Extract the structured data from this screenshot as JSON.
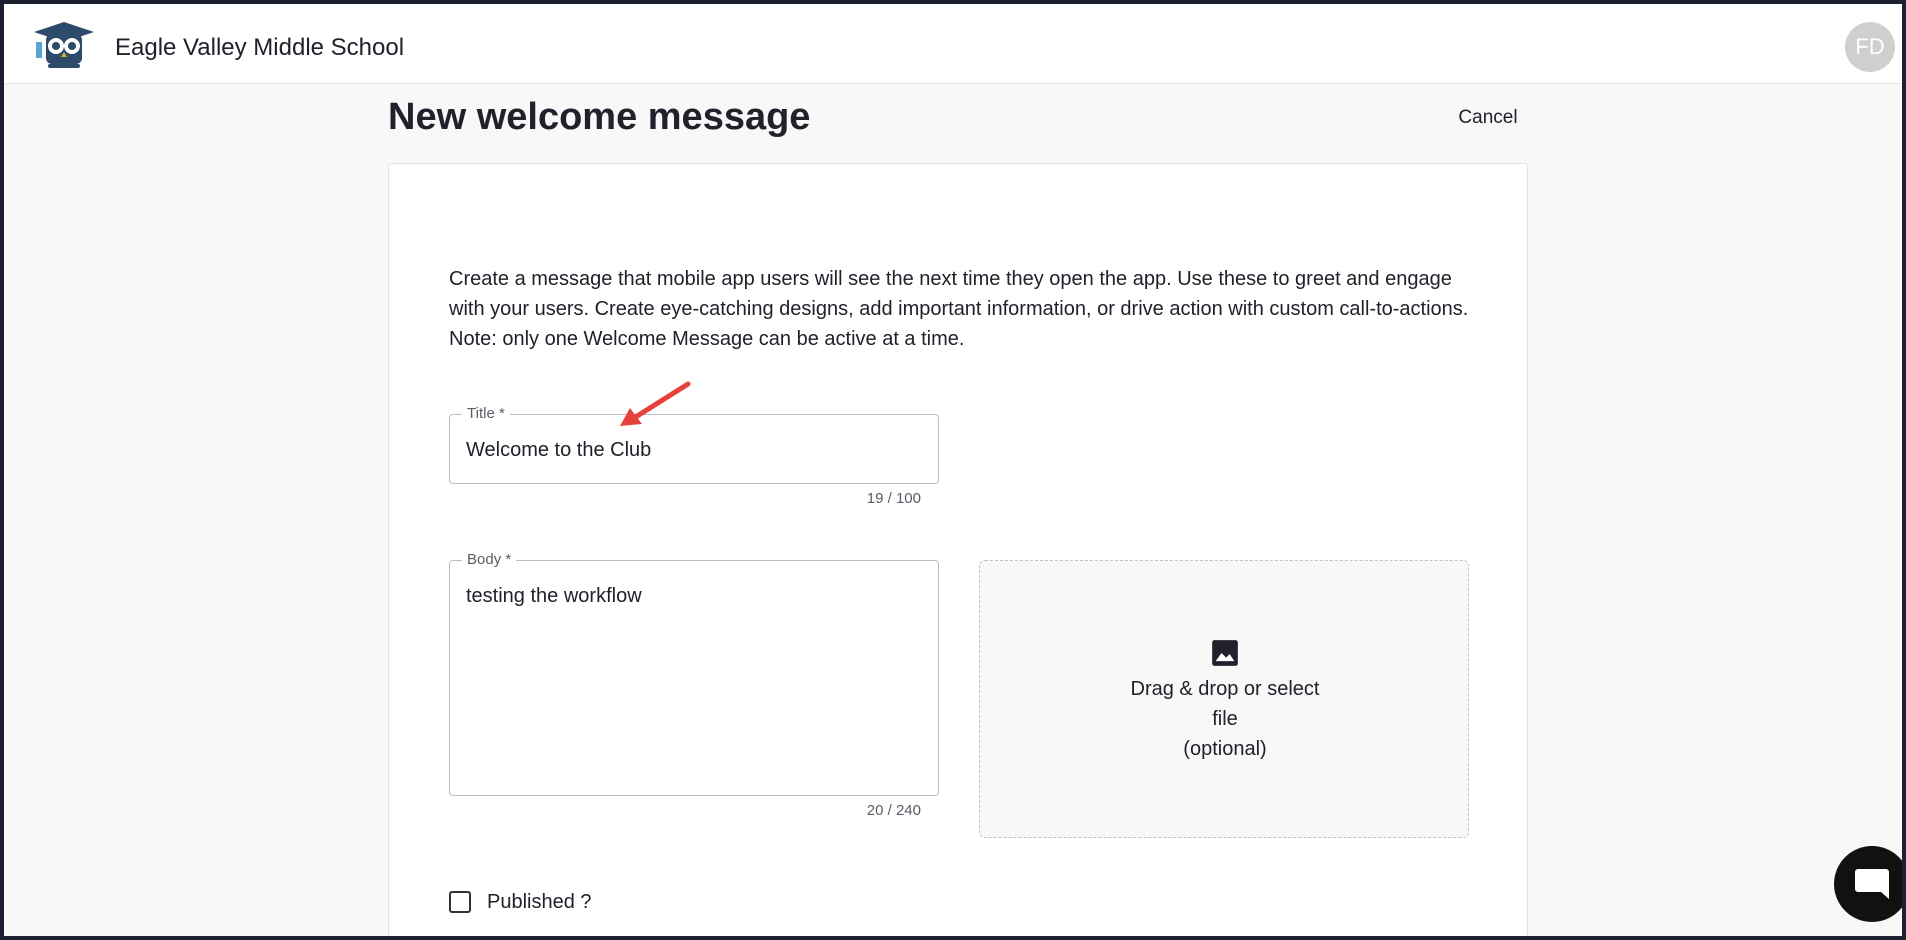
{
  "header": {
    "school_name": "Eagle Valley Middle School",
    "logo_icon": "owl-graduate-logo",
    "avatar_initials": "FD"
  },
  "page": {
    "title": "New welcome message",
    "cancel_label": "Cancel",
    "description": "Create a message that mobile app users will see the next time they open the app. Use these to greet and engage with your users. Create eye-catching designs, add important information, or drive action with custom call-to-actions. Note: only one Welcome Message can be active at a time."
  },
  "form": {
    "title_field": {
      "label": "Title *",
      "value": "Welcome to the Club",
      "counter": "19 / 100"
    },
    "body_field": {
      "label": "Body *",
      "value": "testing the workflow",
      "counter": "20 / 240"
    },
    "image_upload": {
      "icon": "image-icon",
      "line1": "Drag & drop or select",
      "line2": "file",
      "line3": "(optional)"
    },
    "published": {
      "label": "Published ?",
      "checked": false
    }
  },
  "annotation": {
    "icon": "red-arrow-annotation",
    "color": "#e8413c"
  },
  "chat": {
    "icon": "chat-bubble-icon"
  }
}
